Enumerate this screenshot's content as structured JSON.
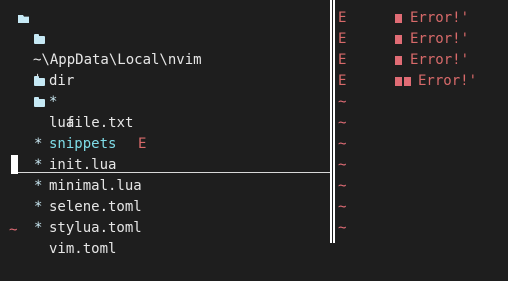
{
  "explorer": {
    "root_path": "~\\AppData\\Local\\nvim",
    "items": [
      {
        "name": "dir",
        "type": "folder"
      },
      {
        "name": "file.txt",
        "type": "file",
        "branch": "└",
        "marker": "E"
      },
      {
        "name": "lua",
        "type": "folder"
      },
      {
        "name": "snippets",
        "type": "folder",
        "highlight": true
      },
      {
        "name": "init.lua",
        "type": "file",
        "marker": ""
      },
      {
        "name": "minimal.lua",
        "type": "file",
        "marker": ""
      },
      {
        "name": "selene.toml",
        "type": "file",
        "marker": ""
      },
      {
        "name": "stylua.toml",
        "type": "file",
        "marker": ""
      },
      {
        "name": "vim.toml",
        "type": "file",
        "marker": ""
      }
    ],
    "file_glyph": "*",
    "filler": "~"
  },
  "diagnostics": {
    "signs": [
      "E",
      "E",
      "E",
      "E"
    ],
    "messages": [
      "Error!'",
      "Error!'",
      "Error!'",
      "Error!'"
    ],
    "filler": "~"
  },
  "colors": {
    "background": "#1e1e1e",
    "error": "#e06c75",
    "folder": "#c6e9f5",
    "highlight": "#7fdde8"
  }
}
